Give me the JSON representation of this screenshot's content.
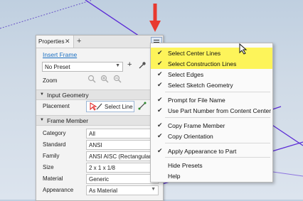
{
  "panel": {
    "tab_label": "Properties",
    "tab_close": "✕",
    "tab_add": "+",
    "insert_frame_link": "Insert Frame",
    "preset_value": "No Preset",
    "preset_add": "+",
    "zoom_label": "Zoom",
    "sections": {
      "input_geometry": "Input Geometry",
      "frame_member": "Frame Member"
    },
    "placement_label": "Placement",
    "select_line_label": "Select Line",
    "rows": [
      {
        "label": "Category",
        "value": "All",
        "dropdown": true
      },
      {
        "label": "Standard",
        "value": "ANSI",
        "dropdown": true
      },
      {
        "label": "Family",
        "value": "ANSI AISC (Rectangular...",
        "dropdown": true
      },
      {
        "label": "Size",
        "value": "2 x 1 x 1/8",
        "dropdown": true
      },
      {
        "label": "Material",
        "value": "Generic",
        "dropdown": true
      },
      {
        "label": "Appearance",
        "value": "As Material",
        "dropdown": true
      }
    ]
  },
  "menu": {
    "items": [
      {
        "label": "Select Center Lines",
        "checked": true,
        "highlight": true
      },
      {
        "label": "Select Construction Lines",
        "checked": true,
        "highlight": true
      },
      {
        "label": "Select Edges",
        "checked": true,
        "highlight": false
      },
      {
        "label": "Select Sketch Geometry",
        "checked": true,
        "highlight": false
      },
      {
        "label": "Prompt for File Name",
        "checked": true,
        "highlight": false
      },
      {
        "label": "Use Part Number from Content Center",
        "checked": true,
        "highlight": false
      },
      {
        "label": "Copy Frame Member",
        "checked": true,
        "highlight": false
      },
      {
        "label": "Copy Orientation",
        "checked": true,
        "highlight": false
      },
      {
        "label": "Apply Appearance to Part",
        "checked": true,
        "highlight": false
      },
      {
        "label": "Hide Presets",
        "checked": false,
        "highlight": false
      },
      {
        "label": "Help",
        "checked": false,
        "highlight": false
      }
    ],
    "check_glyph": "✔"
  },
  "colors": {
    "highlight": "#fdf45a",
    "link": "#1a6fc2",
    "arrow": "#e8392f",
    "sketch_line": "#5b2bd6"
  }
}
